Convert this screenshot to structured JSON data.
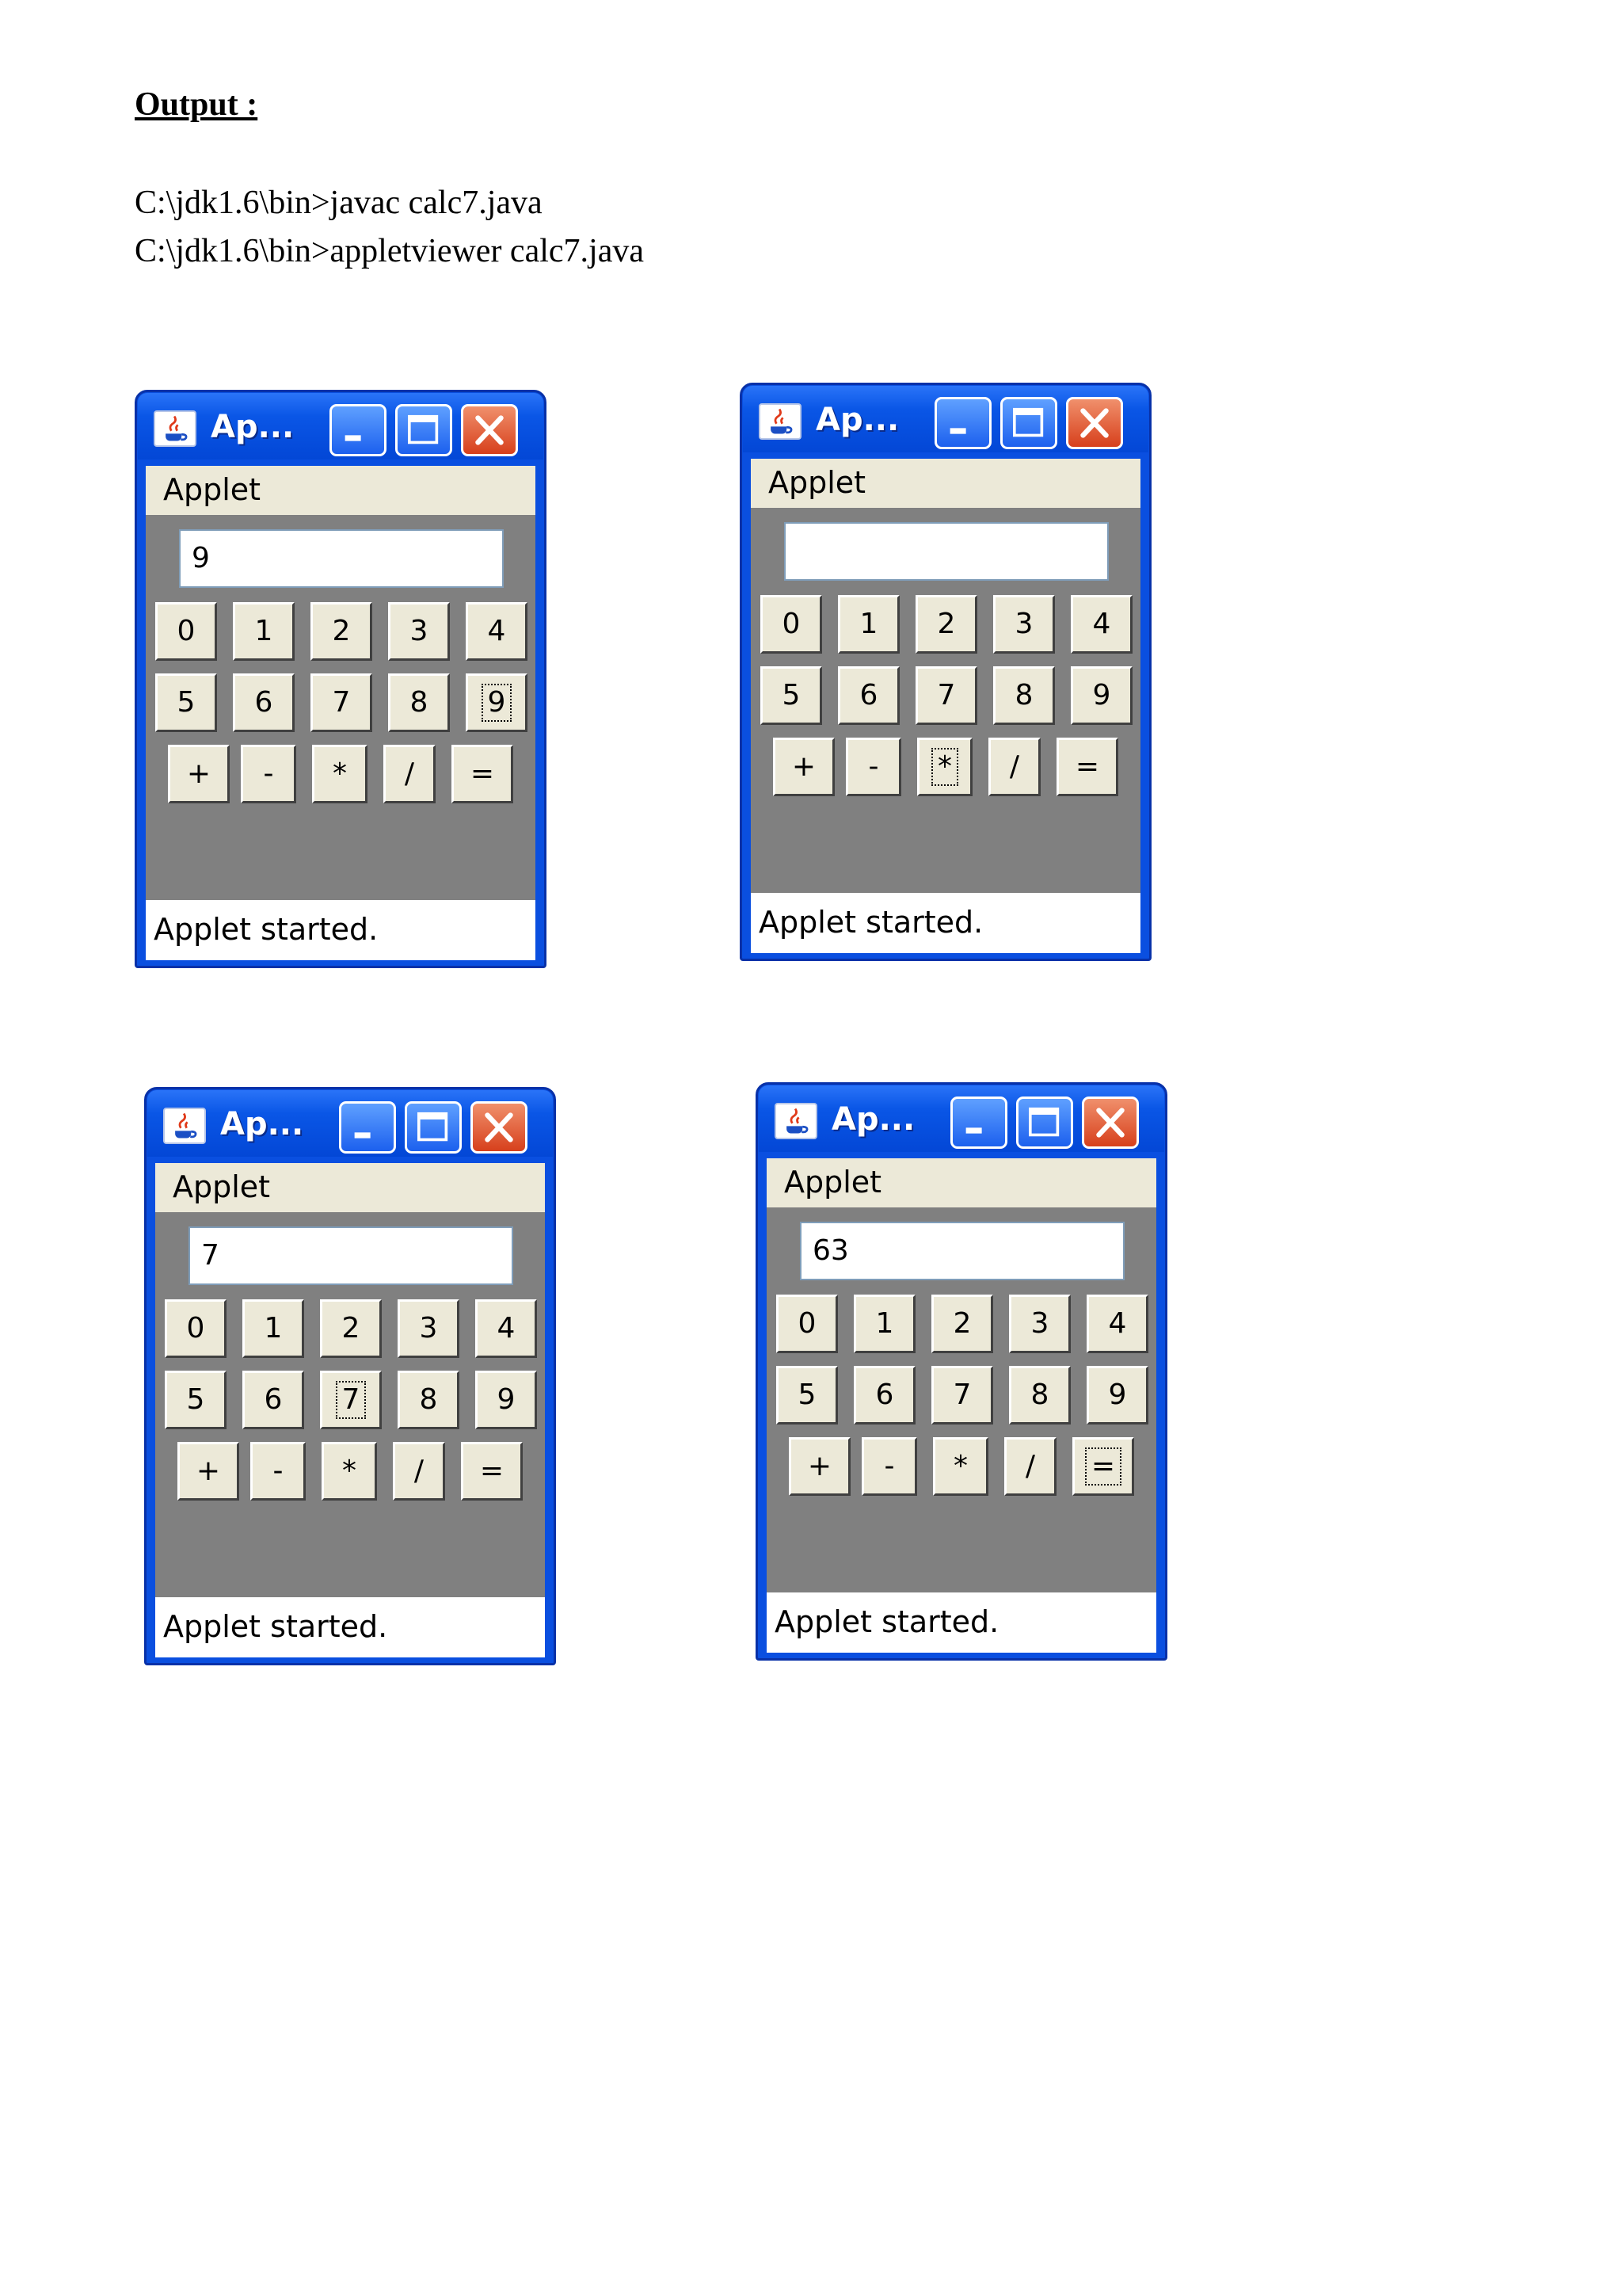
{
  "heading": "Output :",
  "commands": [
    "C:\\jdk1.6\\bin>javac calc7.java",
    "C:\\jdk1.6\\bin>appletviewer calc7.java"
  ],
  "windows": [
    {
      "title": "Ap...",
      "menu": "Applet",
      "display": "9",
      "focused_key": "9",
      "status": "Applet started."
    },
    {
      "title": "Ap...",
      "menu": "Applet",
      "display": "",
      "focused_key": "*",
      "status": "Applet started."
    },
    {
      "title": "Ap...",
      "menu": "Applet",
      "display": "7",
      "focused_key": "7",
      "status": "Applet started."
    },
    {
      "title": "Ap...",
      "menu": "Applet",
      "display": "63",
      "focused_key": "=",
      "status": "Applet started."
    }
  ],
  "keys": {
    "row1": [
      "0",
      "1",
      "2",
      "3",
      "4"
    ],
    "row2": [
      "5",
      "6",
      "7",
      "8",
      "9"
    ],
    "row3": [
      "+",
      "-",
      "*",
      "/",
      "="
    ]
  },
  "icons": {
    "window_icon": "java-cup-icon",
    "minimize": "minimize-icon",
    "maximize": "maximize-icon",
    "close": "close-icon"
  },
  "colors": {
    "titlebar": "#0a56e6",
    "close_button": "#d7401c",
    "applet_background": "#808080",
    "key_face": "#ece9d8"
  }
}
